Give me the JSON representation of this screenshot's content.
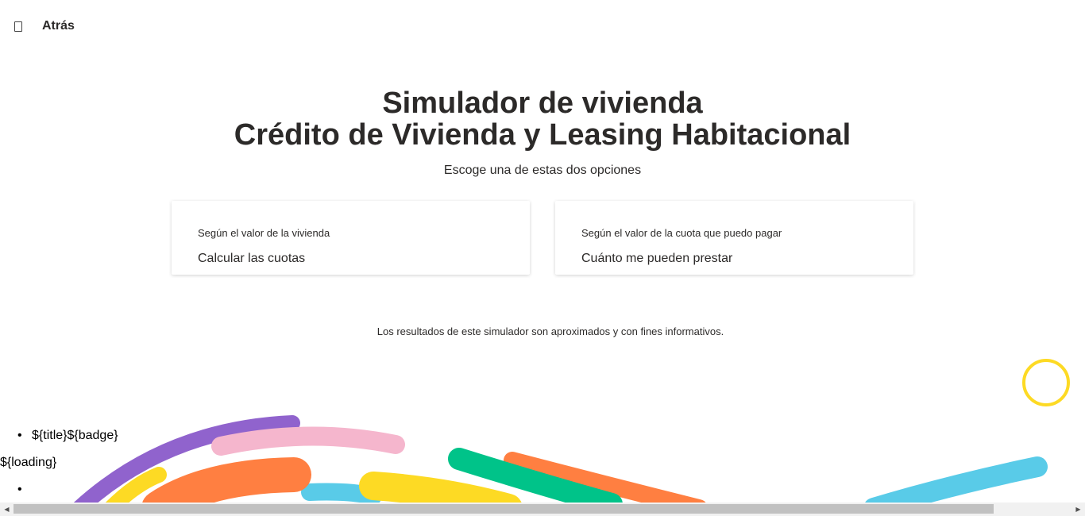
{
  "nav": {
    "back_label": "Atrás"
  },
  "hero": {
    "title_line1": "Simulador de vivienda",
    "title_line2": "Crédito de Vivienda y Leasing Habitacional",
    "subtitle": "Escoge una de estas dos opciones"
  },
  "options": [
    {
      "caption": "Según el valor de la vivienda",
      "title": "Calcular las cuotas"
    },
    {
      "caption": "Según el valor de la cuota que puedo pagar",
      "title": "Cuánto me pueden prestar"
    }
  ],
  "disclaimer": "Los resultados de este simulador son aproximados y con fines informativos.",
  "raw_template": {
    "item_text": "${title}${badge}",
    "loading_text": "${loading}"
  },
  "icons": {
    "back": "back-icon",
    "help": "help-circle",
    "scroll_left": "chevron-left-icon",
    "scroll_right": "chevron-right-icon"
  },
  "colors": {
    "accent_yellow": "#fdda24",
    "purple": "#9063cd",
    "pink": "#f5b6cd",
    "orange": "#ff7f41",
    "green": "#00c389",
    "light_blue": "#59cbe8",
    "text": "#2c2a29"
  }
}
